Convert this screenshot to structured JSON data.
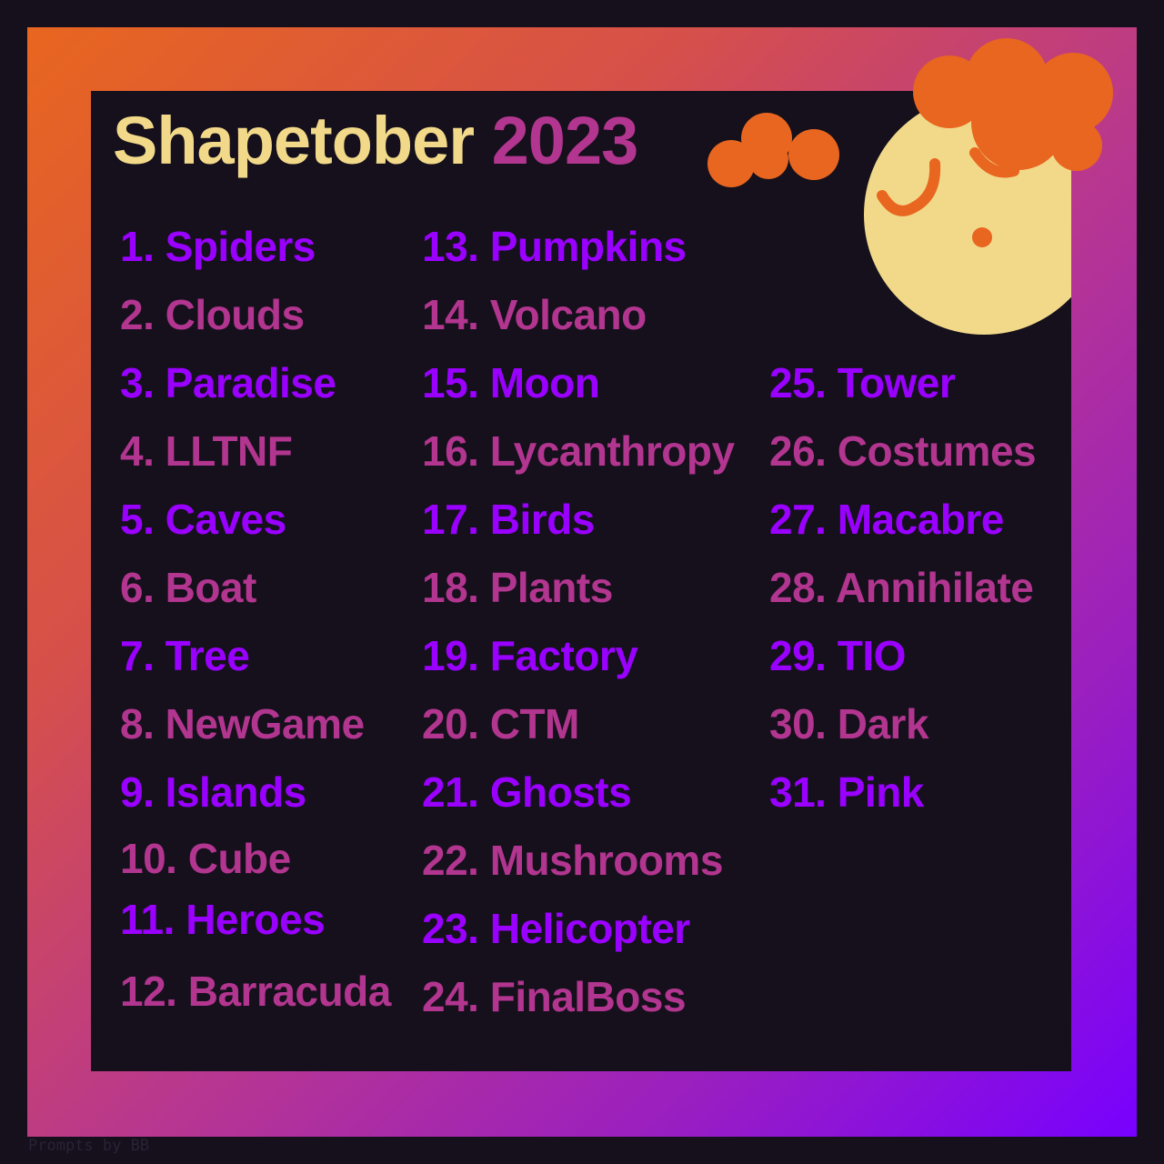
{
  "title": {
    "word": "Shapetober",
    "year": "2023"
  },
  "colors": {
    "background": "#15101c",
    "title_word": "#f2d98a",
    "title_year": "#b2358f",
    "odd_item": "#9a00ff",
    "even_item": "#b2358f",
    "moon": "#f2d98a",
    "hair_cloud": "#e8661f",
    "frame_gradient": [
      "#e8661f",
      "#b8378f",
      "#7800ff"
    ]
  },
  "prompts": [
    {
      "n": "1.",
      "label": "Spiders"
    },
    {
      "n": "2.",
      "label": "Clouds"
    },
    {
      "n": "3.",
      "label": "Paradise"
    },
    {
      "n": "4.",
      "label": "LLTNF"
    },
    {
      "n": "5.",
      "label": "Caves"
    },
    {
      "n": "6.",
      "label": "Boat"
    },
    {
      "n": "7.",
      "label": "Tree"
    },
    {
      "n": "8.",
      "label": "NewGame"
    },
    {
      "n": "9.",
      "label": "Islands"
    },
    {
      "n": "10.",
      "label": "Cube"
    },
    {
      "n": "11.",
      "label": "Heroes"
    },
    {
      "n": "12.",
      "label": "Barracuda"
    },
    {
      "n": "13.",
      "label": "Pumpkins"
    },
    {
      "n": "14.",
      "label": "Volcano"
    },
    {
      "n": "15.",
      "label": "Moon"
    },
    {
      "n": "16.",
      "label": "Lycanthropy"
    },
    {
      "n": "17.",
      "label": "Birds"
    },
    {
      "n": "18.",
      "label": "Plants"
    },
    {
      "n": "19.",
      "label": "Factory"
    },
    {
      "n": "20.",
      "label": "CTM"
    },
    {
      "n": "21.",
      "label": "Ghosts"
    },
    {
      "n": "22.",
      "label": "Mushrooms"
    },
    {
      "n": "23.",
      "label": "Helicopter"
    },
    {
      "n": "24.",
      "label": "FinalBoss"
    },
    {
      "n": "25.",
      "label": "Tower"
    },
    {
      "n": "26.",
      "label": "Costumes"
    },
    {
      "n": "27.",
      "label": "Macabre"
    },
    {
      "n": "28.",
      "label": "Annihilate"
    },
    {
      "n": "29.",
      "label": "TIO"
    },
    {
      "n": "30.",
      "label": "Dark"
    },
    {
      "n": "31.",
      "label": "Pink"
    }
  ],
  "credit": "Prompts by BB"
}
